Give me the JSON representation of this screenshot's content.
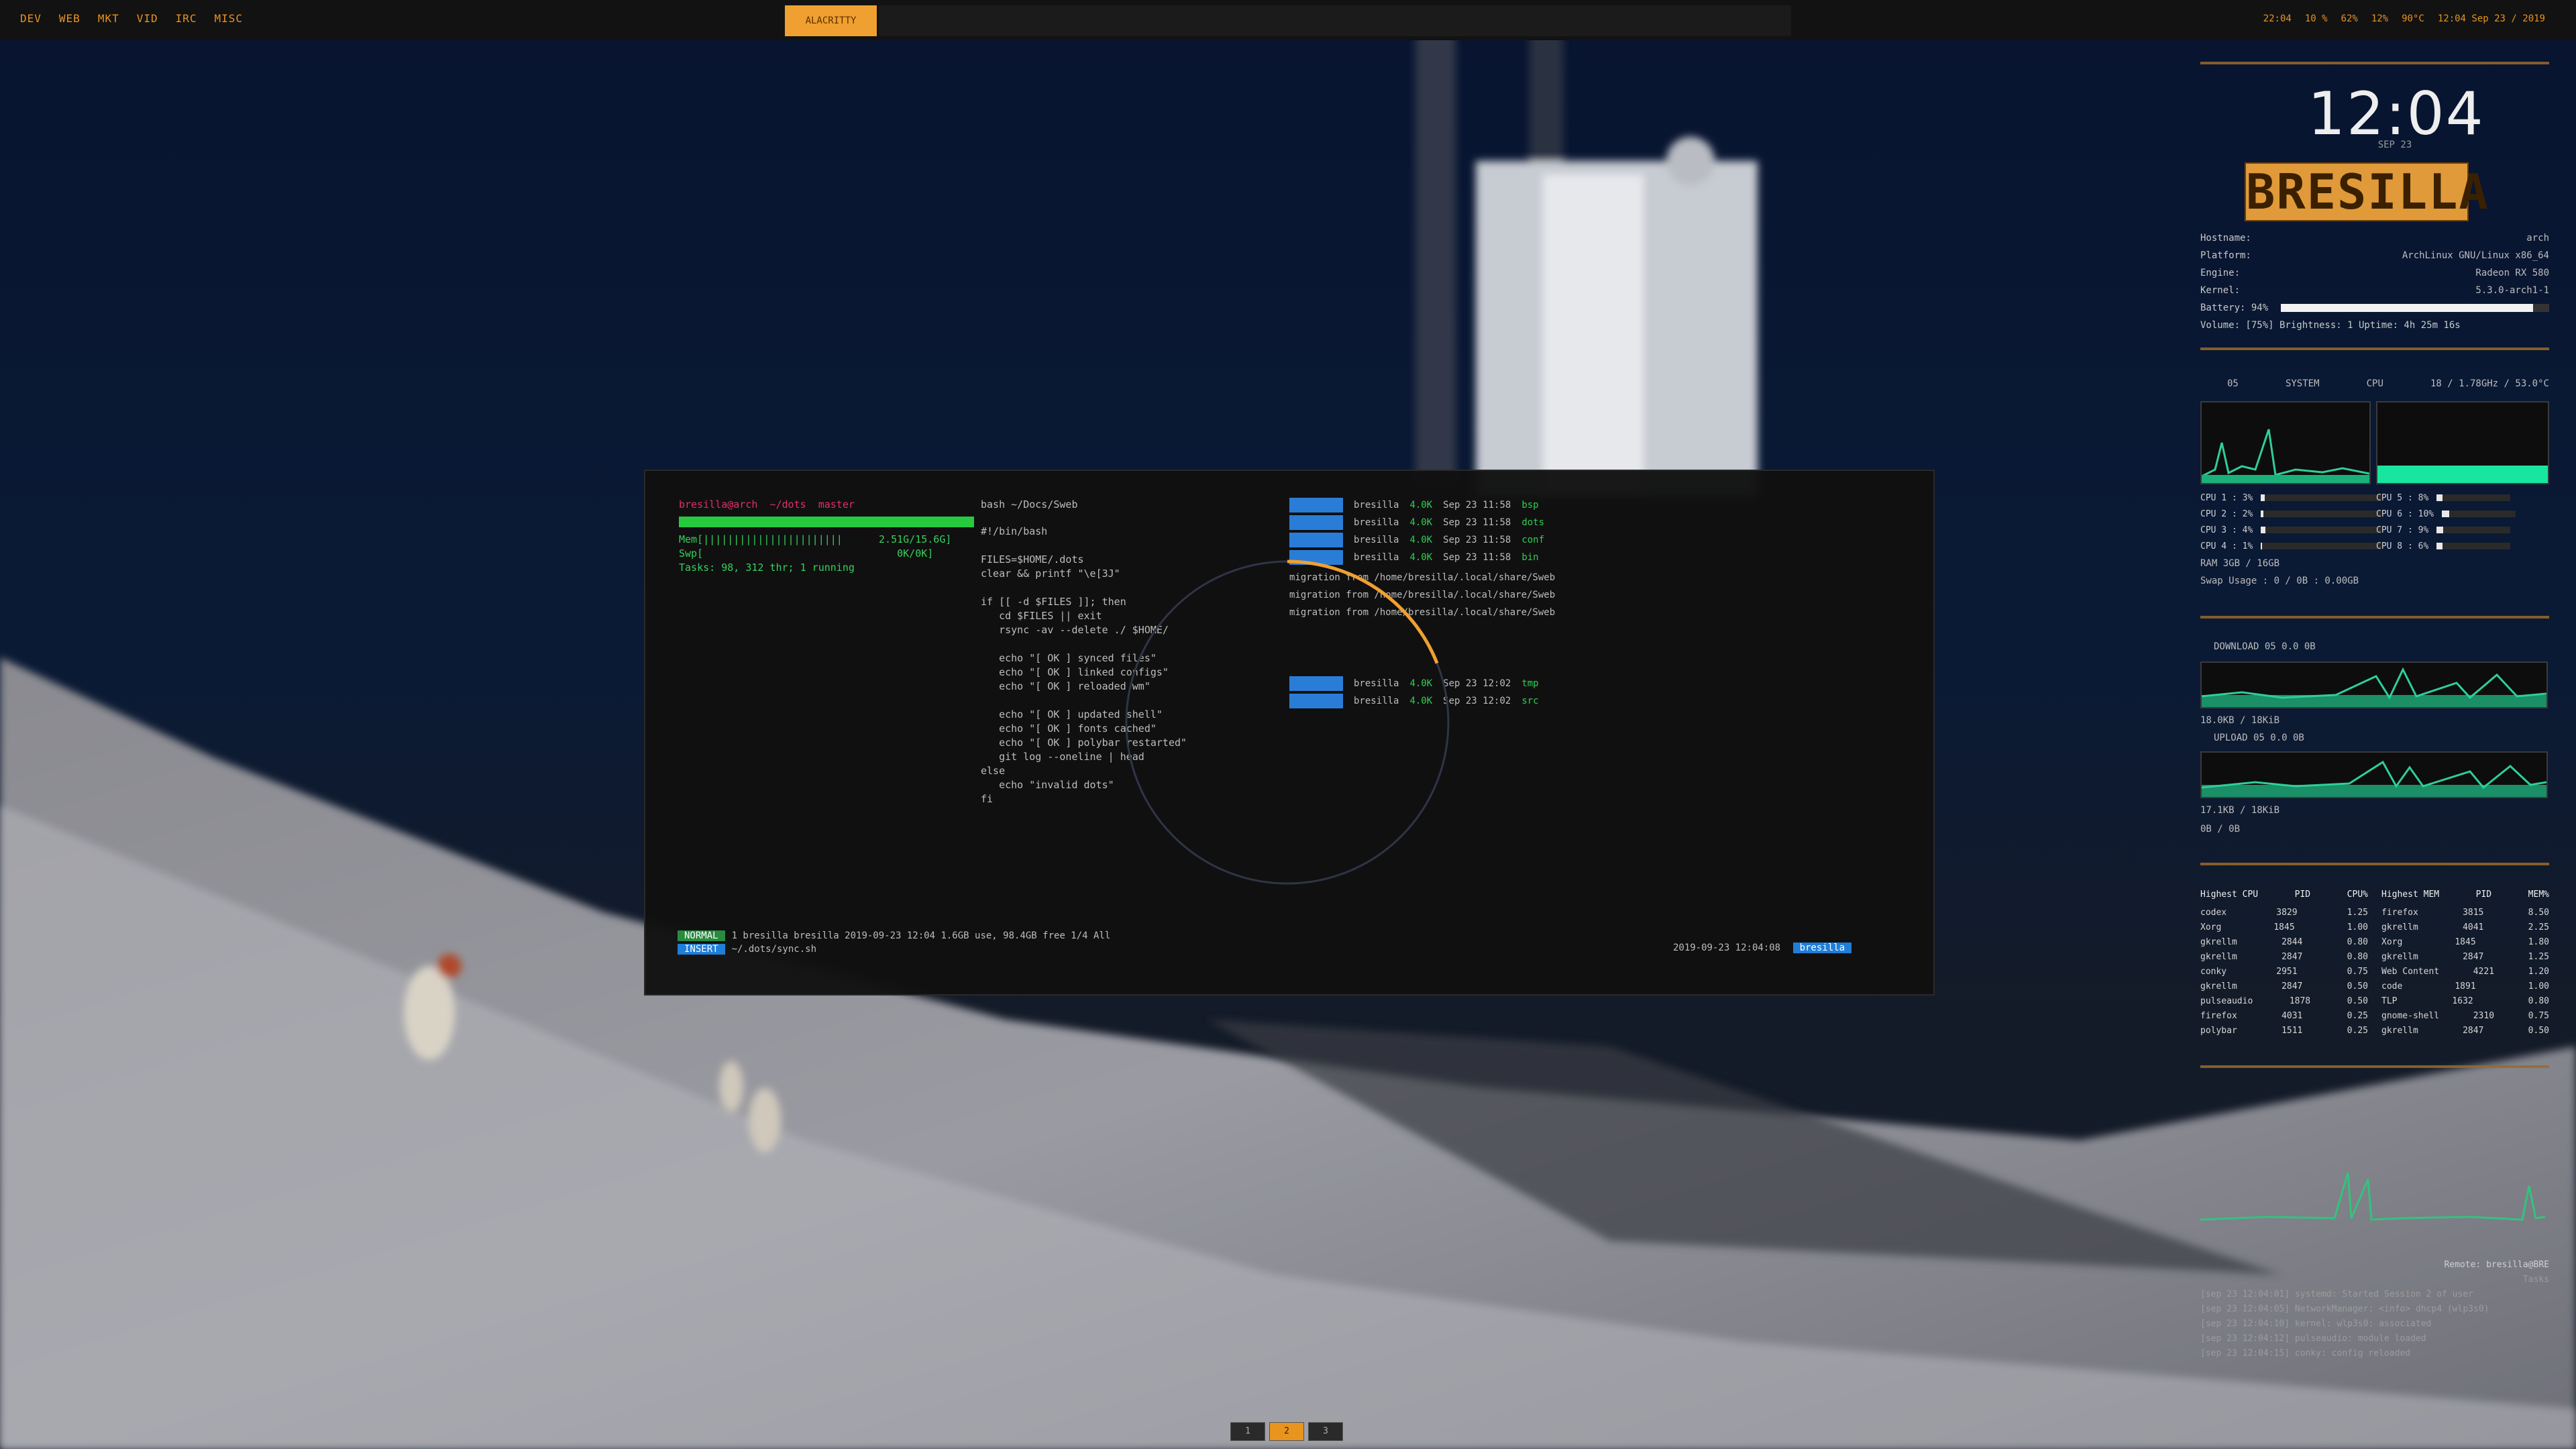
{
  "colors": {
    "accent": "#e8941f",
    "terminal_bg": "#111111",
    "green": "#35d25a",
    "blue": "#1f7ed8"
  },
  "topbar": {
    "tags": [
      "DEV",
      "WEB",
      "MKT",
      "VID",
      "IRC",
      "MISC"
    ],
    "active_window": "ALACRITTY",
    "status": [
      "22:04",
      "10 %",
      "62%",
      "12%",
      "90°C",
      "12:04 Sep 23 / 2019"
    ]
  },
  "panel": {
    "clock": "12:04",
    "clock_sub": "SEP 23",
    "hostname_badge": "BRESILLA",
    "sysinfo": [
      {
        "k": "Hostname:",
        "v": "arch"
      },
      {
        "k": "Platform:",
        "v": "ArchLinux GNU/Linux x86_64"
      },
      {
        "k": "Engine:",
        "v": "Radeon RX 580"
      },
      {
        "k": "Kernel:",
        "v": "5.3.0-arch1-1"
      }
    ],
    "battery_label": "Battery: 94%",
    "battery_pct": 0.94,
    "volume_line": "Volume: [75%]   Brightness: 1   Uptime: 4h 25m 16s",
    "cpu_head": [
      "05",
      "SYSTEM",
      "CPU",
      "18 / 1.78GHz / 53.0°C"
    ],
    "cores_left": [
      {
        "label": "CPU 1 :  3%",
        "pct": 0.03
      },
      {
        "label": "CPU 2 :  2%",
        "pct": 0.02
      },
      {
        "label": "CPU 3 :  4%",
        "pct": 0.04
      },
      {
        "label": "CPU 4 :  1%",
        "pct": 0.01
      }
    ],
    "cores_right": [
      {
        "label": "CPU 5 :  8%",
        "pct": 0.08
      },
      {
        "label": "CPU 6 : 10%",
        "pct": 0.1
      },
      {
        "label": "CPU 7 :  9%",
        "pct": 0.09
      },
      {
        "label": "CPU 8 :  6%",
        "pct": 0.08
      }
    ],
    "ram_line": "RAM                    3GB / 16GB",
    "swap_line": "Swap Usage : 0 / 0B          : 0.00GB",
    "net_down_head": "DOWNLOAD   05   0.0   0B",
    "net_down_total": "18.0KB / 18KiB",
    "net_up_head": "UPLOAD   05   0.0   0B",
    "net_up_total": "17.1KB / 18KiB",
    "disk_line": "0B / 0B",
    "proc_left_head": [
      "Highest CPU",
      "PID",
      "CPU%"
    ],
    "proc_right_head": [
      "Highest MEM",
      "PID",
      "MEM%"
    ],
    "proc_left": [
      [
        "codex",
        "3829",
        "1.25"
      ],
      [
        "Xorg",
        "1845",
        "1.00"
      ],
      [
        "gkrellm",
        "2844",
        "0.80"
      ],
      [
        "gkrellm",
        "2847",
        "0.80"
      ],
      [
        "conky",
        "2951",
        "0.75"
      ],
      [
        "gkrellm",
        "2847",
        "0.50"
      ],
      [
        "pulseaudio",
        "1878",
        "0.50"
      ],
      [
        "firefox",
        "4031",
        "0.25"
      ],
      [
        "polybar",
        "1511",
        "0.25"
      ]
    ],
    "proc_right": [
      [
        "firefox",
        "3815",
        "8.50"
      ],
      [
        "gkrellm",
        "4041",
        "2.25"
      ],
      [
        "Xorg",
        "1845",
        "1.80"
      ],
      [
        "gkrellm",
        "2847",
        "1.25"
      ],
      [
        "Web Content",
        "4221",
        "1.20"
      ],
      [
        "code",
        "1891",
        "1.00"
      ],
      [
        "TLP",
        "1632",
        "0.80"
      ],
      [
        "gnome-shell",
        "2310",
        "0.75"
      ],
      [
        "gkrellm",
        "2847",
        "0.50"
      ]
    ],
    "log_lines": [
      "Remote: bresilla@BRE",
      "Tasks",
      "[sep 23 12:04:01] systemd: Started Session 2 of user",
      "[sep 23 12:04:05] NetworkManager: <info> dhcp4 (wlp3s0)",
      "[sep 23 12:04:10] kernel: wlp3s0: associated",
      "[sep 23 12:04:12] pulseaudio: module loaded",
      "[sep 23 12:04:15] conky: config reloaded"
    ],
    "tray": [
      "◐",
      "⚙",
      "♪",
      "◉",
      "☰",
      "⏻"
    ]
  },
  "terminal": {
    "left_header": "bresilla@arch  ~/dots  master",
    "left_mid_header": "bash ~/Docs/Sweb",
    "htop_lines": [
      "Mem[|||||||||||||||||||||||      2.51G/15.6G]",
      "Swp[                                0K/0K]",
      "Tasks: 98, 312 thr; 1 running"
    ],
    "code_lines": [
      "#!/bin/bash",
      "",
      "FILES=$HOME/.dots",
      "clear && printf \"\\e[3J\"",
      "",
      "if [[ -d $FILES ]]; then",
      "   cd $FILES || exit",
      "   rsync -av --delete ./ $HOME/",
      "",
      "   echo \"[ OK ] synced files\"",
      "   echo \"[ OK ] linked configs\"",
      "   echo \"[ OK ] reloaded wm\"",
      "",
      "   echo \"[ OK ] updated shell\"",
      "   echo \"[ OK ] fonts cached\"",
      "   echo \"[ OK ] polybar restarted\"",
      "   git log --oneline | head",
      "else",
      "   echo \"invalid dots\"",
      "fi"
    ],
    "ls_top": [
      {
        "name": "bresilla",
        "size": "4.0K",
        "date": "Sep 23 11:58",
        "tag": "bsp"
      },
      {
        "name": "bresilla",
        "size": "4.0K",
        "date": "Sep 23 11:58",
        "tag": "dots"
      },
      {
        "name": "bresilla",
        "size": "4.0K",
        "date": "Sep 23 11:58",
        "tag": "conf"
      },
      {
        "name": "bresilla",
        "size": "4.0K",
        "date": "Sep 23 11:58",
        "tag": "bin"
      }
    ],
    "ls_paths": [
      "migration  from /home/bresilla/.local/share/Sweb",
      "migration  from /home/bresilla/.local/share/Sweb",
      "migration  from /home/bresilla/.local/share/Sweb"
    ],
    "ls_bottom": [
      {
        "name": "bresilla",
        "size": "4.0K",
        "date": "Sep 23 12:02",
        "tag": "tmp"
      },
      {
        "name": "bresilla",
        "size": "4.0K",
        "date": "Sep 23 12:02",
        "tag": "src"
      }
    ],
    "ring_progress": 0.19,
    "status_mode": "NORMAL",
    "status_text": "1  bresilla  bresilla  2019-09-23 12:04    1.6GB  use, 98.4GB free   1/4   All",
    "status_mode2": "INSERT",
    "status_text2": "~/.dots/sync.sh",
    "status_right": "2019-09-23 12:04:08",
    "status_right_tag": "bresilla"
  },
  "workspaces": {
    "items": [
      "1",
      "2",
      "3"
    ],
    "active_index": 1
  }
}
